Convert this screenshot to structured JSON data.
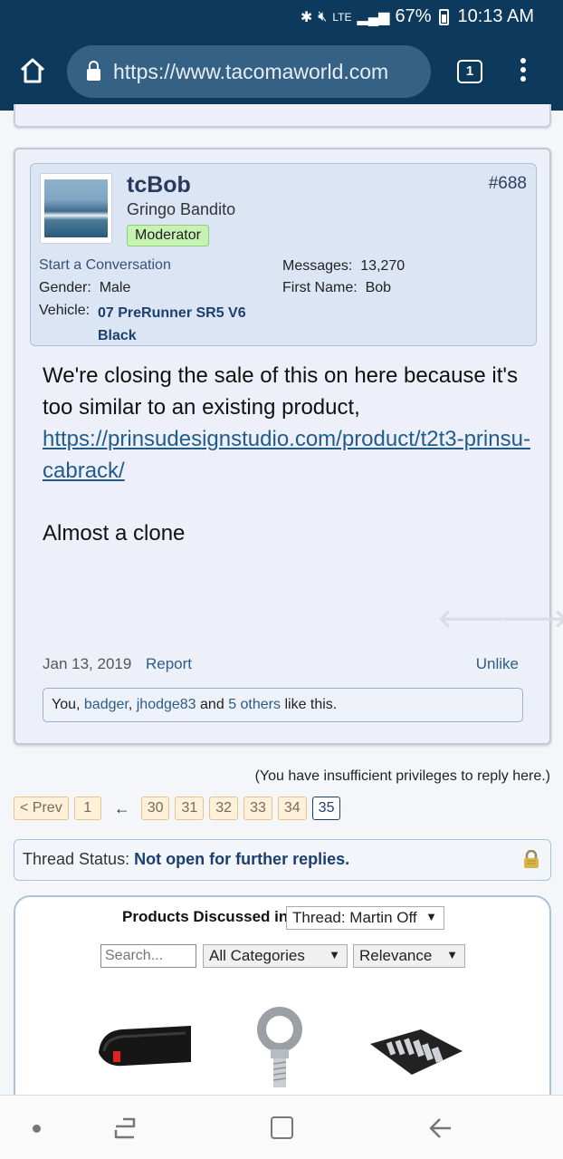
{
  "status_bar": {
    "icons": [
      "bluetooth-icon",
      "mute-icon",
      "lte-icon",
      "signal-icon",
      "battery-icon"
    ],
    "lte": "LTE",
    "battery": "67%",
    "time": "10:13 AM"
  },
  "browser": {
    "url": "https://www.tacomaworld.com",
    "tab_count": "1"
  },
  "post": {
    "username": "tcBob",
    "user_title": "Gringo Bandito",
    "badge": "Moderator",
    "post_number": "#688",
    "start_conversation": "Start a Conversation",
    "gender_label": "Gender:",
    "gender_value": "Male",
    "vehicle_label": "Vehicle:",
    "vehicle_value": "07 PreRunner SR5 V6 Black",
    "messages_label": "Messages:",
    "messages_value": "13,270",
    "first_name_label": "First Name:",
    "first_name_value": "Bob",
    "message_text": "We're closing the sale of this on here because it's too similar to an existing product,",
    "message_link": "https://prinsudesignstudio.com/product/t2t3-prinsu-cabrack/",
    "message_text2": "Almost a clone",
    "date": "Jan 13, 2019",
    "report_label": "Report",
    "unlike_label": "Unlike",
    "likes": {
      "you": "You,",
      "user1": "badger",
      "user2": "jhodge83",
      "and": "and",
      "others": "5 others",
      "suffix": "like this."
    }
  },
  "insufficient_privileges": "(You have insufficient privileges to reply here.)",
  "pagination": {
    "prev": "< Prev",
    "first": "1",
    "arrow": "←",
    "pages": [
      "30",
      "31",
      "32",
      "33",
      "34"
    ],
    "current": "35"
  },
  "thread_status": {
    "label": "Thread Status:",
    "value": "Not open for further replies."
  },
  "products": {
    "title": "Products Discussed in",
    "thread_select": "Thread: Martin Off",
    "search_placeholder": "Search...",
    "category_select": "All Categories",
    "sort_select": "Relevance",
    "items": [
      "edge-trim-seal-image",
      "eye-bolt-image",
      "tool-kit-image"
    ]
  },
  "colors": {
    "header_bg": "#0d3a5c",
    "link": "#2a5d8a",
    "badge_bg": "#c6f2b3"
  }
}
